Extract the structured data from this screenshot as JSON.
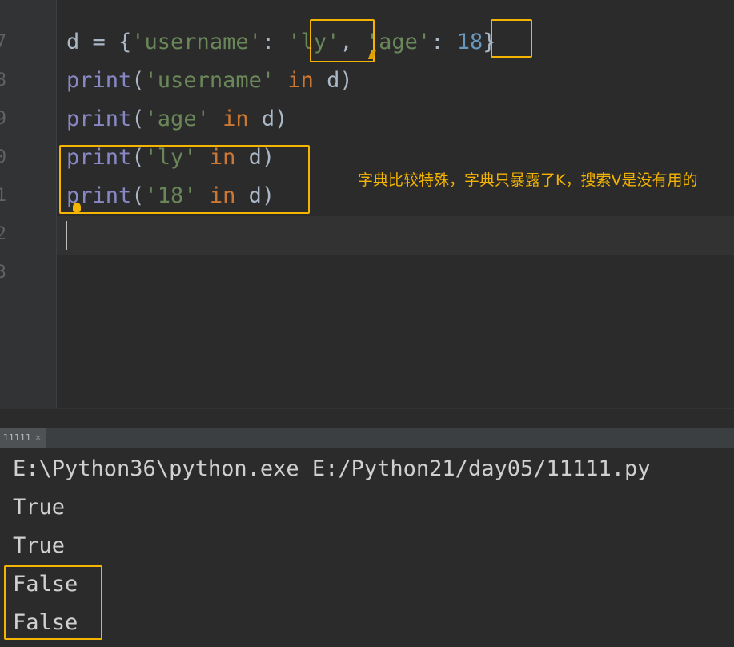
{
  "editor": {
    "line_numbers": [
      "7",
      "8",
      "9",
      "0",
      "1",
      "2",
      "3"
    ],
    "lines": [
      {
        "tokens": [
          {
            "t": "d = {",
            "c": "plain"
          },
          {
            "t": "'username'",
            "c": "str"
          },
          {
            "t": ": ",
            "c": "plain"
          },
          {
            "t": "'ly'",
            "c": "str"
          },
          {
            "t": ", ",
            "c": "plain"
          },
          {
            "t": "'age'",
            "c": "str"
          },
          {
            "t": ": ",
            "c": "plain"
          },
          {
            "t": "18",
            "c": "num"
          },
          {
            "t": "}",
            "c": "plain"
          }
        ]
      },
      {
        "tokens": [
          {
            "t": "print",
            "c": "fn"
          },
          {
            "t": "(",
            "c": "plain"
          },
          {
            "t": "'username'",
            "c": "str"
          },
          {
            "t": " ",
            "c": "plain"
          },
          {
            "t": "in",
            "c": "kw"
          },
          {
            "t": " d)",
            "c": "plain"
          }
        ]
      },
      {
        "tokens": [
          {
            "t": "print",
            "c": "fn"
          },
          {
            "t": "(",
            "c": "plain"
          },
          {
            "t": "'age'",
            "c": "str"
          },
          {
            "t": " ",
            "c": "plain"
          },
          {
            "t": "in",
            "c": "kw"
          },
          {
            "t": " d)",
            "c": "plain"
          }
        ]
      },
      {
        "tokens": [
          {
            "t": "print",
            "c": "fn"
          },
          {
            "t": "(",
            "c": "plain"
          },
          {
            "t": "'ly'",
            "c": "str"
          },
          {
            "t": " ",
            "c": "plain"
          },
          {
            "t": "in",
            "c": "kw"
          },
          {
            "t": " d)",
            "c": "plain"
          }
        ]
      },
      {
        "tokens": [
          {
            "t": "print",
            "c": "fn"
          },
          {
            "t": "(",
            "c": "plain"
          },
          {
            "t": "'18'",
            "c": "str"
          },
          {
            "t": " ",
            "c": "plain"
          },
          {
            "t": "in",
            "c": "kw"
          },
          {
            "t": " d)",
            "c": "plain"
          }
        ]
      }
    ],
    "annotation": "字典比较特殊，字典只暴露了K，搜索V是没有用的",
    "colors": {
      "keyword": "#cc7832",
      "builtin": "#8888c6",
      "string": "#6a8759",
      "number": "#6897bb",
      "text": "#a9b7c6",
      "highlight": "#f5b400"
    }
  },
  "run_panel": {
    "tab_label": "11111",
    "close_glyph": "×",
    "command": "E:\\Python36\\python.exe E:/Python21/day05/11111.py",
    "outputs": [
      "True",
      "True",
      "False",
      "False"
    ]
  }
}
